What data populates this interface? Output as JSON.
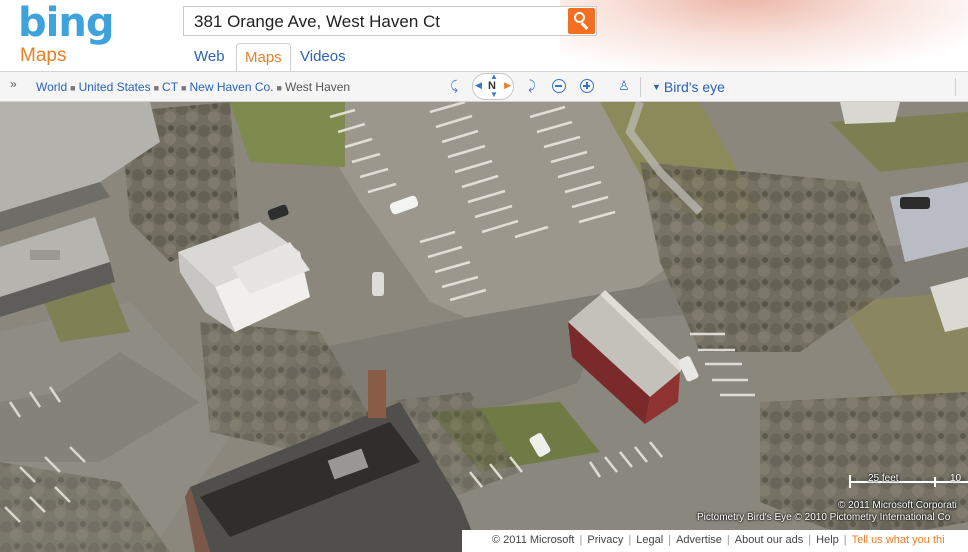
{
  "header": {
    "logo": "bing",
    "product": "Maps",
    "search": {
      "value": "381 Orange Ave, West Haven Ct",
      "button_icon": "search-icon"
    },
    "tabs": [
      {
        "label": "Web",
        "active": false
      },
      {
        "label": "Maps",
        "active": true
      },
      {
        "label": "Videos",
        "active": false
      }
    ]
  },
  "toolbar": {
    "breadcrumb": [
      "World",
      "United States",
      "CT",
      "New Haven Co.",
      "West Haven"
    ],
    "compass_label": "N",
    "view_mode": "Bird's eye",
    "icons": [
      "expand-icon",
      "rotate-left-icon",
      "compass-icon",
      "rotate-right-icon",
      "zoom-out-icon",
      "zoom-in-icon",
      "streetside-person-icon",
      "dropdown-arrow-icon"
    ]
  },
  "map": {
    "scale_label": "25 feet",
    "scale_label_2": "10",
    "copyright_1": "© 2011 Microsoft Corporati",
    "copyright_2": "Pictometry Bird's Eye © 2010 Pictometry International Co"
  },
  "footer": {
    "links": [
      "© 2011 Microsoft",
      "Privacy",
      "Legal",
      "Advertise",
      "About our ads",
      "Help",
      "Tell us what you thi"
    ],
    "accent": "#e87f26"
  },
  "colors": {
    "brand_blue": "#3ea3dd",
    "accent_orange": "#e87f26",
    "link_blue": "#2a62b8"
  }
}
